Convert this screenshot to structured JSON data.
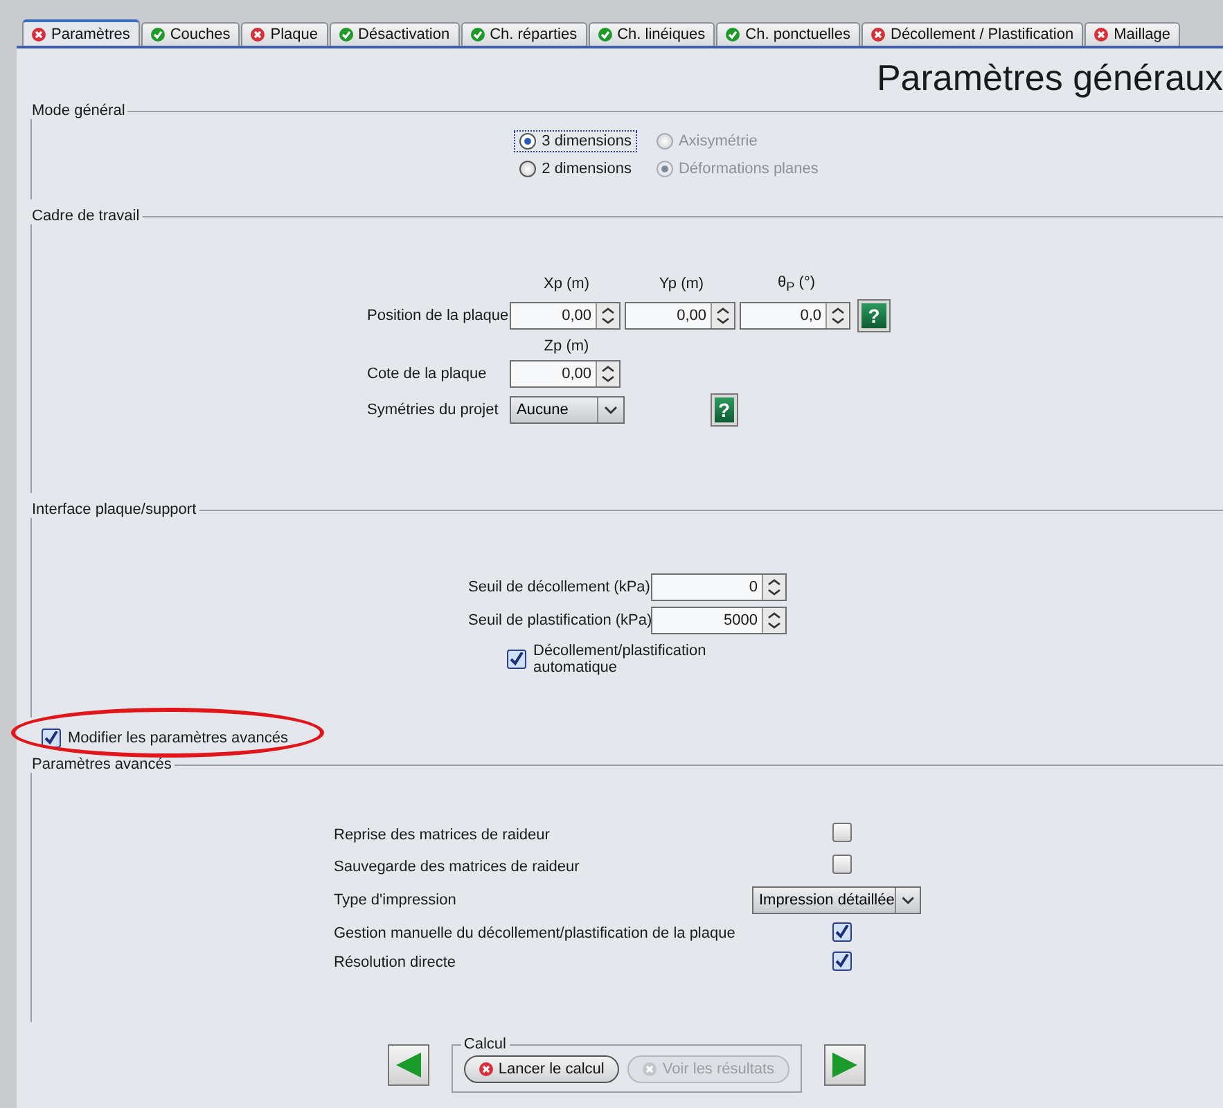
{
  "tabs": [
    {
      "label": "Paramètres",
      "kind": "error",
      "selected": true
    },
    {
      "label": "Couches",
      "kind": "ok",
      "selected": false
    },
    {
      "label": "Plaque",
      "kind": "error",
      "selected": false
    },
    {
      "label": "Désactivation",
      "kind": "ok",
      "selected": false
    },
    {
      "label": "Ch. réparties",
      "kind": "ok",
      "selected": false
    },
    {
      "label": "Ch. linéiques",
      "kind": "ok",
      "selected": false
    },
    {
      "label": "Ch. ponctuelles",
      "kind": "ok",
      "selected": false
    },
    {
      "label": "Décollement / Plastification",
      "kind": "error",
      "selected": false
    },
    {
      "label": "Maillage",
      "kind": "error",
      "selected": false
    }
  ],
  "page_title": "Paramètres généraux",
  "mode_general": {
    "title": "Mode général",
    "options": [
      {
        "label": "3 dimensions",
        "selected": true,
        "disabled": false,
        "focused": true
      },
      {
        "label": "Axisymétrie",
        "selected": false,
        "disabled": true,
        "focused": false
      },
      {
        "label": "2 dimensions",
        "selected": false,
        "disabled": false,
        "focused": false
      },
      {
        "label": "Déformations planes",
        "selected": true,
        "disabled": true,
        "focused": false
      }
    ]
  },
  "cadre": {
    "title": "Cadre de travail",
    "position_label": "Position de la plaque",
    "columns": [
      "Xp (m)",
      "Yp (m)",
      "θ$_{P}$ (°)"
    ],
    "position_values": [
      "0,00",
      "0,00",
      "0,0"
    ],
    "help": "?",
    "cote_header": "Zp (m)",
    "cote_label": "Cote de la plaque",
    "cote_value": "0,00",
    "symetries_label": "Symétries du projet",
    "symetries_value": "Aucune",
    "symetries_help": "?"
  },
  "interface": {
    "title": "Interface plaque/support",
    "fields": [
      {
        "label": "Seuil de décollement (kPa)",
        "value": "0"
      },
      {
        "label": "Seuil de plastification (kPa)",
        "value": "5000"
      }
    ],
    "auto": {
      "label": "Décollement/plastification automatique",
      "checked": true
    }
  },
  "modifier": {
    "label": "Modifier les paramètres avancés",
    "checked": true
  },
  "avances": {
    "title": "Paramètres avancés",
    "rows": [
      {
        "kind": "checkbox",
        "label": "Reprise des matrices de raideur",
        "checked": false
      },
      {
        "kind": "checkbox",
        "label": "Sauvegarde des matrices de raideur",
        "checked": false
      },
      {
        "kind": "select",
        "label": "Type d'impression",
        "value": "Impression détaillée"
      },
      {
        "kind": "checkbox",
        "label": "Gestion manuelle du décollement/plastification de la plaque",
        "checked": true
      },
      {
        "kind": "checkbox",
        "label": "Résolution directe",
        "checked": true
      }
    ]
  },
  "calcul": {
    "title": "Calcul",
    "buttons": [
      {
        "label": "Lancer le calcul",
        "disabled": false
      },
      {
        "label": "Voir les résultats",
        "disabled": true
      }
    ]
  }
}
